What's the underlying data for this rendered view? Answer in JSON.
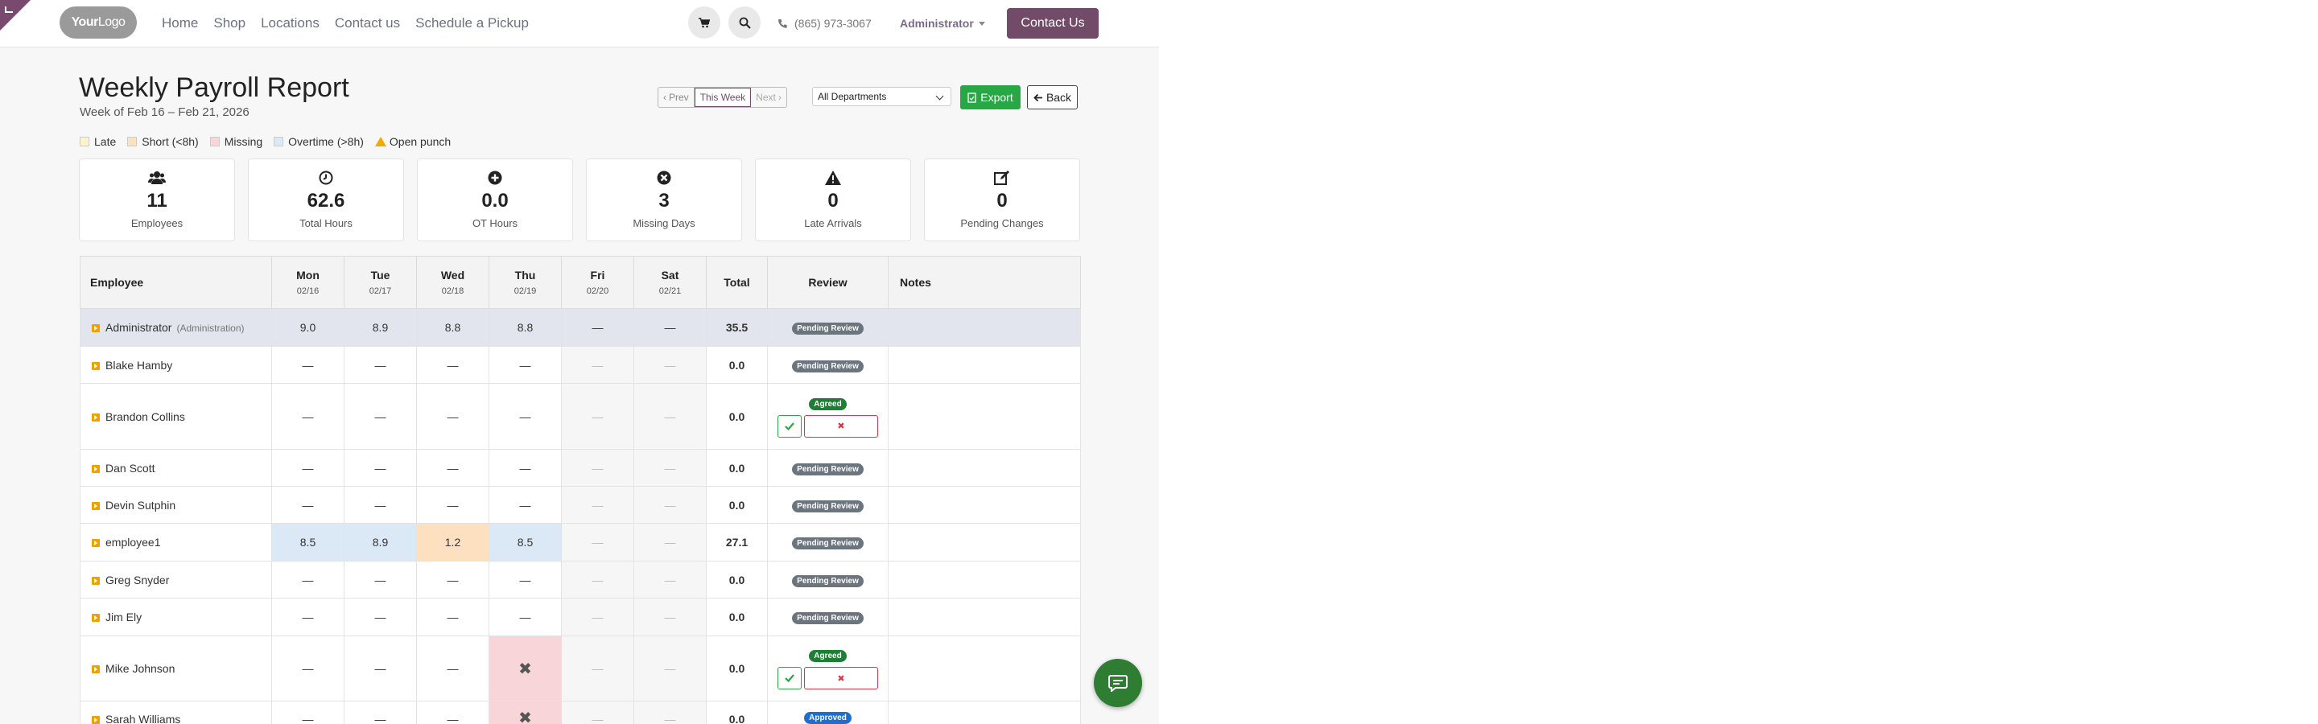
{
  "header": {
    "logo_bold": "Your",
    "logo_light": "Logo",
    "nav": [
      "Home",
      "Shop",
      "Locations",
      "Contact us",
      "Schedule a Pickup"
    ],
    "phone": "(865) 973-3067",
    "user": "Administrator",
    "contact_btn": "Contact Us"
  },
  "page": {
    "title": "Weekly Payroll Report",
    "subtitle": "Week of Feb 16 – Feb 21, 2026",
    "prev": "Prev",
    "this_week": "This Week",
    "next": "Next",
    "department_selected": "All Departments",
    "export": "Export",
    "back": "Back"
  },
  "legend": [
    {
      "label": "Late",
      "color": "#fff3cd"
    },
    {
      "label": "Short (<8h)",
      "color": "#fde0bf"
    },
    {
      "label": "Missing",
      "color": "#f8d5d8"
    },
    {
      "label": "Overtime (>8h)",
      "color": "#dbe9f6"
    },
    {
      "label": "Open punch",
      "color": "#f0ad00"
    }
  ],
  "stats": [
    {
      "icon": "users-icon",
      "value": "11",
      "label": "Employees"
    },
    {
      "icon": "clock-icon",
      "value": "62.6",
      "label": "Total Hours"
    },
    {
      "icon": "plus-circle-icon",
      "value": "0.0",
      "label": "OT Hours"
    },
    {
      "icon": "x-circle-icon",
      "value": "3",
      "label": "Missing Days"
    },
    {
      "icon": "warning-icon",
      "value": "0",
      "label": "Late Arrivals"
    },
    {
      "icon": "edit-icon",
      "value": "0",
      "label": "Pending Changes"
    }
  ],
  "table": {
    "headers": {
      "employee": "Employee",
      "total": "Total",
      "review": "Review",
      "notes": "Notes"
    },
    "days": [
      {
        "day": "Mon",
        "date": "02/16"
      },
      {
        "day": "Tue",
        "date": "02/17"
      },
      {
        "day": "Wed",
        "date": "02/18"
      },
      {
        "day": "Thu",
        "date": "02/19"
      },
      {
        "day": "Fri",
        "date": "02/20"
      },
      {
        "day": "Sat",
        "date": "02/21"
      }
    ],
    "rows": [
      {
        "name": "Administrator",
        "dept": "(Administration)",
        "cells": [
          "9.0",
          "8.9",
          "8.8",
          "8.8",
          "—",
          "—"
        ],
        "total": "35.5",
        "review": "Pending Review"
      },
      {
        "name": "Blake Hamby",
        "cells": [
          "—",
          "—",
          "—",
          "—",
          "—",
          "—"
        ],
        "total": "0.0",
        "review": "Pending Review"
      },
      {
        "name": "Brandon Collins",
        "cells": [
          "—",
          "—",
          "—",
          "—",
          "—",
          "—"
        ],
        "total": "0.0",
        "review": "Agreed"
      },
      {
        "name": "Dan Scott",
        "cells": [
          "—",
          "—",
          "—",
          "—",
          "—",
          "—"
        ],
        "total": "0.0",
        "review": "Pending Review"
      },
      {
        "name": "Devin Sutphin",
        "cells": [
          "—",
          "—",
          "—",
          "—",
          "—",
          "—"
        ],
        "total": "0.0",
        "review": "Pending Review"
      },
      {
        "name": "employee1",
        "cells": [
          "8.5",
          "8.9",
          "1.2",
          "8.5",
          "—",
          "—"
        ],
        "total": "27.1",
        "review": "Pending Review"
      },
      {
        "name": "Greg Snyder",
        "cells": [
          "—",
          "—",
          "—",
          "—",
          "—",
          "—"
        ],
        "total": "0.0",
        "review": "Pending Review"
      },
      {
        "name": "Jim Ely",
        "cells": [
          "—",
          "—",
          "—",
          "—",
          "—",
          "—"
        ],
        "total": "0.0",
        "review": "Pending Review"
      },
      {
        "name": "Mike Johnson",
        "cells": [
          "—",
          "—",
          "—",
          "✖",
          "—",
          "—"
        ],
        "total": "0.0",
        "review": "Agreed"
      },
      {
        "name": "Sarah Williams",
        "cells": [
          "—",
          "—",
          "—",
          "✖",
          "—",
          "—"
        ],
        "total": "0.0",
        "review": "Approved"
      }
    ]
  },
  "colors": {
    "brand": "#714b67",
    "success": "#28a745",
    "danger": "#dc3545"
  }
}
